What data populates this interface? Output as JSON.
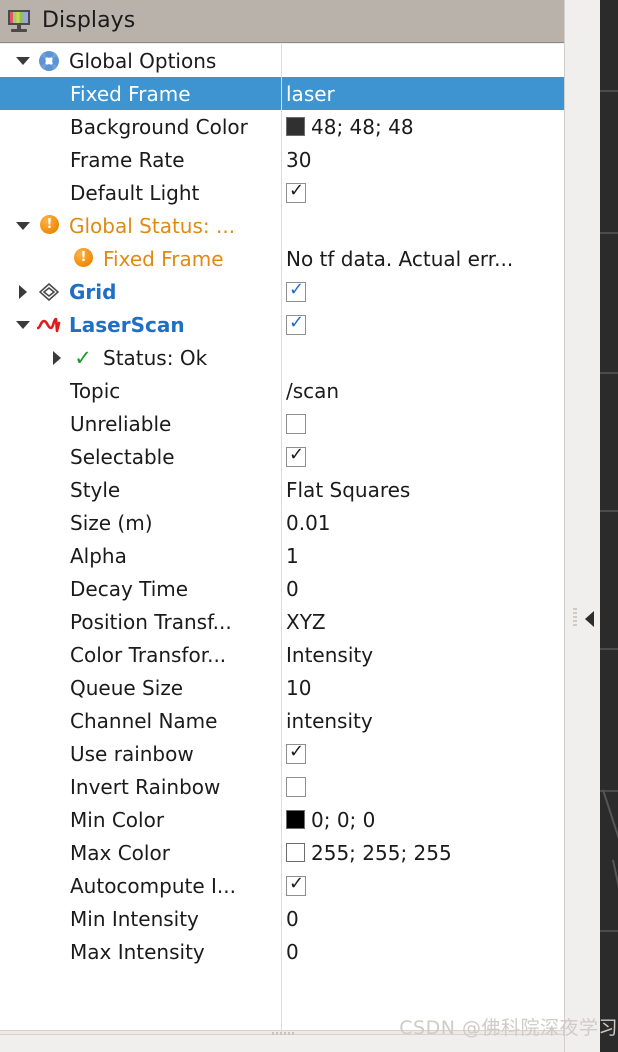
{
  "window": {
    "title": "Displays",
    "icon": "displays-monitor-icon",
    "close_label": "✖"
  },
  "colors": {
    "selection": "#3d94d1",
    "title_bar": "#b8b2ab",
    "link_blue": "#1f6fc4",
    "warning_orange": "#e08a16",
    "ok_green": "#17992b",
    "background_color_swatch": "#303030",
    "min_color_swatch": "#000000",
    "max_color_swatch": "#ffffff"
  },
  "tree": [
    {
      "id": "global-options",
      "indent": 0,
      "expander": "down",
      "icon": "flower-icon",
      "label": "Global Options",
      "label_style": "plain",
      "value_type": "none",
      "value": "",
      "selected": false
    },
    {
      "id": "fixed-frame",
      "indent": 1,
      "expander": "none",
      "icon": "none",
      "label": "Fixed Frame",
      "label_style": "plain",
      "value_type": "text",
      "value": "laser",
      "selected": true
    },
    {
      "id": "background-color",
      "indent": 1,
      "expander": "none",
      "icon": "none",
      "label": "Background Color",
      "label_style": "plain",
      "value_type": "swatch",
      "value": "48; 48; 48",
      "swatch": "#303030",
      "selected": false
    },
    {
      "id": "frame-rate",
      "indent": 1,
      "expander": "none",
      "icon": "none",
      "label": "Frame Rate",
      "label_style": "plain",
      "value_type": "text",
      "value": "30",
      "selected": false
    },
    {
      "id": "default-light",
      "indent": 1,
      "expander": "none",
      "icon": "none",
      "label": "Default Light",
      "label_style": "plain",
      "value_type": "checkbox",
      "value": "checked",
      "checkbox_color": "dark",
      "selected": false
    },
    {
      "id": "global-status",
      "indent": 0,
      "expander": "down",
      "icon": "warning-icon",
      "label": "Global Status: ...",
      "label_style": "orange",
      "value_type": "none",
      "value": "",
      "selected": false
    },
    {
      "id": "status-fixed-frame",
      "indent": 1,
      "expander": "none",
      "icon": "warning-icon",
      "label": "Fixed Frame",
      "label_style": "orange",
      "value_type": "text",
      "value": "No tf data.  Actual err...",
      "selected": false
    },
    {
      "id": "grid",
      "indent": 0,
      "expander": "right",
      "icon": "grid-icon",
      "label": "Grid",
      "label_style": "blue",
      "value_type": "checkbox",
      "value": "checked",
      "checkbox_color": "blue",
      "selected": false
    },
    {
      "id": "laserscan",
      "indent": 0,
      "expander": "down",
      "icon": "laserscan-wave-icon",
      "label": "LaserScan",
      "label_style": "blue",
      "value_type": "checkbox",
      "value": "checked",
      "checkbox_color": "blue",
      "selected": false
    },
    {
      "id": "laserscan-status",
      "indent": 1,
      "expander": "right",
      "icon": "check-icon",
      "label": "Status: Ok",
      "label_style": "plain",
      "value_type": "none",
      "value": "",
      "selected": false
    },
    {
      "id": "topic",
      "indent": 1,
      "expander": "none",
      "icon": "none",
      "label": "Topic",
      "label_style": "plain",
      "value_type": "text",
      "value": "/scan",
      "selected": false
    },
    {
      "id": "unreliable",
      "indent": 1,
      "expander": "none",
      "icon": "none",
      "label": "Unreliable",
      "label_style": "plain",
      "value_type": "checkbox",
      "value": "unchecked",
      "checkbox_color": "dark",
      "selected": false
    },
    {
      "id": "selectable",
      "indent": 1,
      "expander": "none",
      "icon": "none",
      "label": "Selectable",
      "label_style": "plain",
      "value_type": "checkbox",
      "value": "checked",
      "checkbox_color": "dark",
      "selected": false
    },
    {
      "id": "style",
      "indent": 1,
      "expander": "none",
      "icon": "none",
      "label": "Style",
      "label_style": "plain",
      "value_type": "text",
      "value": "Flat Squares",
      "selected": false
    },
    {
      "id": "size-m",
      "indent": 1,
      "expander": "none",
      "icon": "none",
      "label": "Size (m)",
      "label_style": "plain",
      "value_type": "text",
      "value": "0.01",
      "selected": false
    },
    {
      "id": "alpha",
      "indent": 1,
      "expander": "none",
      "icon": "none",
      "label": "Alpha",
      "label_style": "plain",
      "value_type": "text",
      "value": "1",
      "selected": false
    },
    {
      "id": "decay-time",
      "indent": 1,
      "expander": "none",
      "icon": "none",
      "label": "Decay Time",
      "label_style": "plain",
      "value_type": "text",
      "value": "0",
      "selected": false
    },
    {
      "id": "position-transformer",
      "indent": 1,
      "expander": "none",
      "icon": "none",
      "label": "Position Transf...",
      "label_style": "plain",
      "value_type": "text",
      "value": "XYZ",
      "selected": false
    },
    {
      "id": "color-transformer",
      "indent": 1,
      "expander": "none",
      "icon": "none",
      "label": "Color Transfor...",
      "label_style": "plain",
      "value_type": "text",
      "value": "Intensity",
      "selected": false
    },
    {
      "id": "queue-size",
      "indent": 1,
      "expander": "none",
      "icon": "none",
      "label": "Queue Size",
      "label_style": "plain",
      "value_type": "text",
      "value": "10",
      "selected": false
    },
    {
      "id": "channel-name",
      "indent": 1,
      "expander": "none",
      "icon": "none",
      "label": "Channel Name",
      "label_style": "plain",
      "value_type": "text",
      "value": "intensity",
      "selected": false
    },
    {
      "id": "use-rainbow",
      "indent": 1,
      "expander": "none",
      "icon": "none",
      "label": "Use rainbow",
      "label_style": "plain",
      "value_type": "checkbox",
      "value": "checked",
      "checkbox_color": "dark",
      "selected": false
    },
    {
      "id": "invert-rainbow",
      "indent": 1,
      "expander": "none",
      "icon": "none",
      "label": "Invert Rainbow",
      "label_style": "plain",
      "value_type": "checkbox",
      "value": "unchecked",
      "checkbox_color": "dark",
      "selected": false
    },
    {
      "id": "min-color",
      "indent": 1,
      "expander": "none",
      "icon": "none",
      "label": "Min Color",
      "label_style": "plain",
      "value_type": "swatch",
      "value": "0; 0; 0",
      "swatch": "#000000",
      "selected": false
    },
    {
      "id": "max-color",
      "indent": 1,
      "expander": "none",
      "icon": "none",
      "label": "Max Color",
      "label_style": "plain",
      "value_type": "swatch",
      "value": "255; 255; 255",
      "swatch": "#ffffff",
      "selected": false
    },
    {
      "id": "autocompute-intensity",
      "indent": 1,
      "expander": "none",
      "icon": "none",
      "label": "Autocompute I...",
      "label_style": "plain",
      "value_type": "checkbox",
      "value": "checked",
      "checkbox_color": "dark",
      "selected": false
    },
    {
      "id": "min-intensity",
      "indent": 1,
      "expander": "none",
      "icon": "none",
      "label": "Min Intensity",
      "label_style": "plain",
      "value_type": "text",
      "value": "0",
      "selected": false
    },
    {
      "id": "max-intensity",
      "indent": 1,
      "expander": "none",
      "icon": "none",
      "label": "Max Intensity",
      "label_style": "plain",
      "value_type": "text",
      "value": "0",
      "selected": false
    }
  ],
  "watermark": {
    "text": "CSDN @佛科院深夜学习"
  },
  "splitter": {
    "collapse_icon": "collapse-left-arrow-icon"
  }
}
